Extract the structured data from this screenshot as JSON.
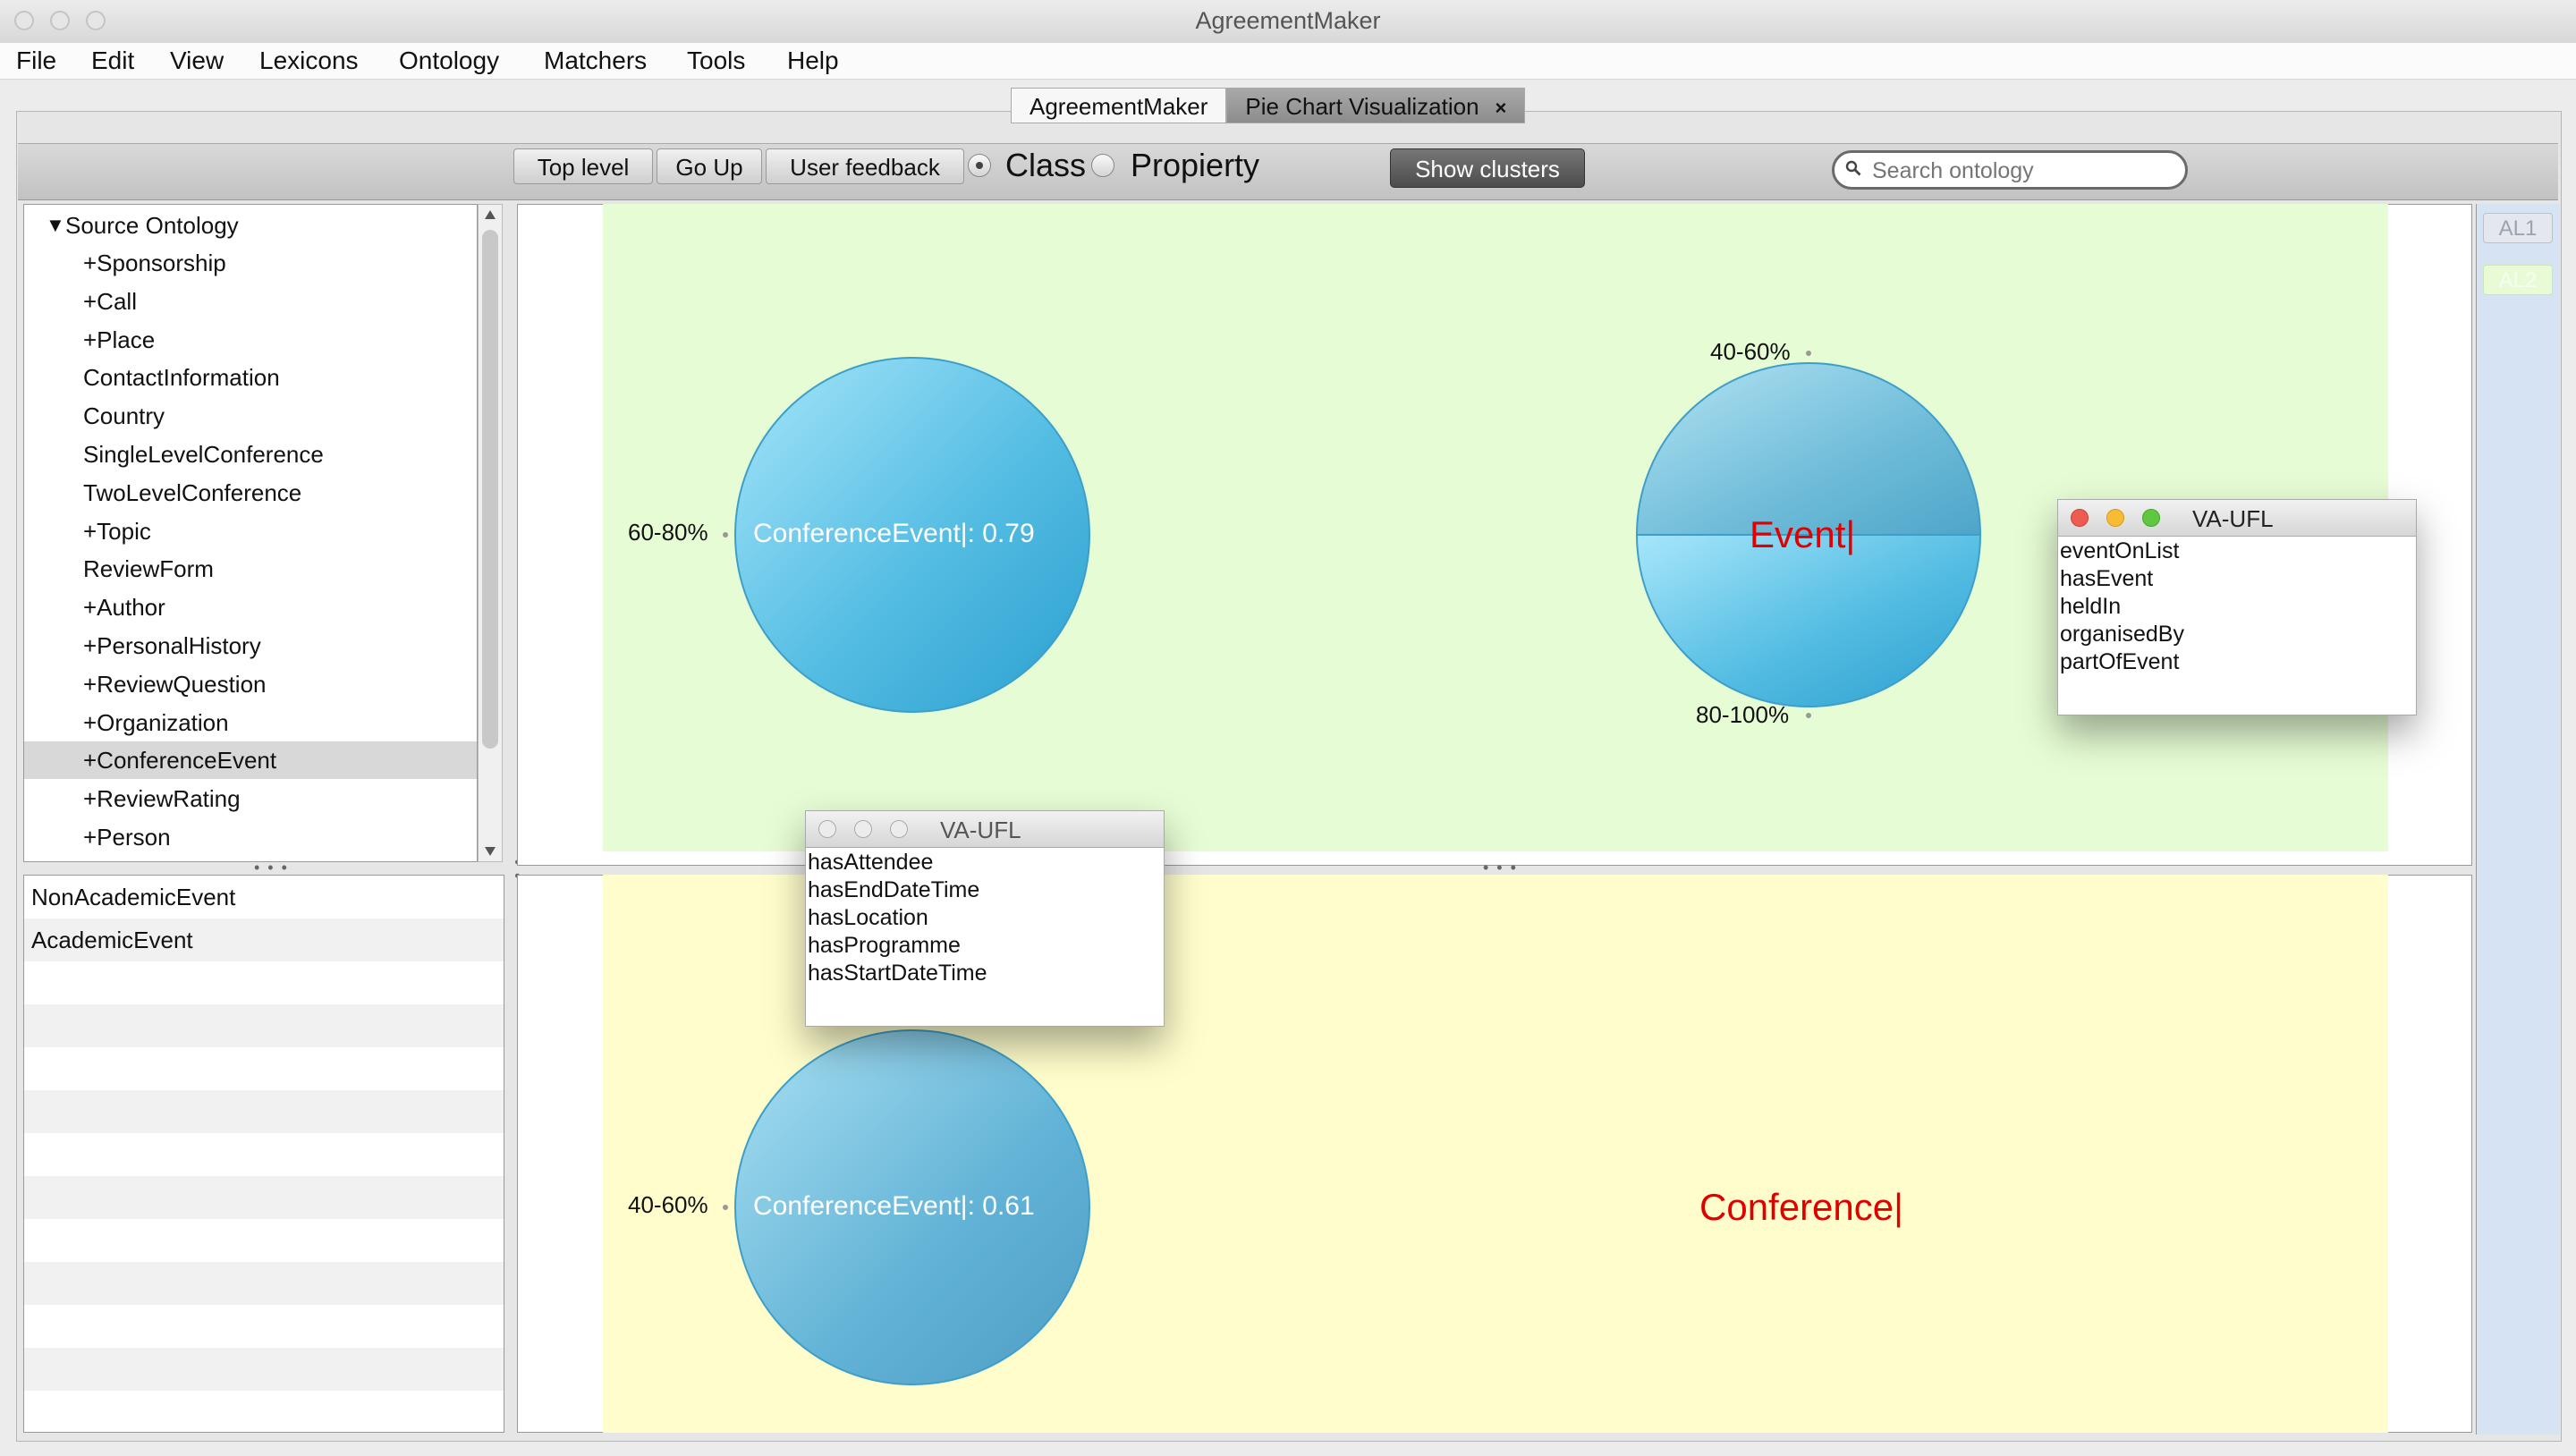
{
  "window": {
    "title": "AgreementMaker"
  },
  "menu": [
    "File",
    "Edit",
    "View",
    "Lexicons",
    "Ontology",
    "Matchers",
    "Tools",
    "Help"
  ],
  "tabs": [
    {
      "label": "AgreementMaker",
      "active": false
    },
    {
      "label": "Pie Chart Visualization",
      "active": true,
      "close": "×"
    }
  ],
  "toolbar": {
    "top_level": "Top level",
    "go_up": "Go Up",
    "user_feedback": "User feedback",
    "radio_class": "Class",
    "radio_property": "Propierty",
    "selected_radio": "Class",
    "show_clusters": "Show clusters",
    "search_placeholder": "Search ontology"
  },
  "tree": {
    "root": "Source Ontology",
    "root_icon": "triangle-down-icon",
    "items": [
      "+Sponsorship",
      "+Call",
      "+Place",
      "ContactInformation",
      "Country",
      "SingleLevelConference",
      "TwoLevelConference",
      "+Topic",
      "ReviewForm",
      "+Author",
      "+PersonalHistory",
      "+ReviewQuestion",
      "+Organization",
      "+ConferenceEvent",
      "+ReviewRating",
      "+Person"
    ],
    "selected": "+ConferenceEvent"
  },
  "list": {
    "items": [
      "NonAcademicEvent",
      "AcademicEvent"
    ]
  },
  "right_strip": {
    "buttons": [
      "AL1",
      "AL2"
    ]
  },
  "pies": {
    "top_left": {
      "label": "ConferenceEvent|: 0.79",
      "range": "60-80%"
    },
    "top_right": {
      "label": "Event|",
      "range_top": "40-60%",
      "range_bottom": "80-100%"
    },
    "bottom_left": {
      "label": "ConferenceEvent|: 0.61",
      "range": "40-60%"
    },
    "bottom_right": {
      "label": "Conference|"
    }
  },
  "popups": {
    "right": {
      "title": "VA-UFL",
      "items": [
        "eventOnList",
        "hasEvent",
        "heldIn",
        "organisedBy",
        "partOfEvent"
      ]
    },
    "left": {
      "title": "VA-UFL",
      "items": [
        "hasAttendee",
        "hasEndDateTime",
        "hasLocation",
        "hasProgramme",
        "hasStartDateTime"
      ]
    }
  },
  "colors": {
    "pie_light": "#9fe0f7",
    "pie_dark": "#1ea2d2",
    "green_bg": "#e6fcd4",
    "yellow_bg": "#fefdcb",
    "red_label": "#e00000"
  }
}
